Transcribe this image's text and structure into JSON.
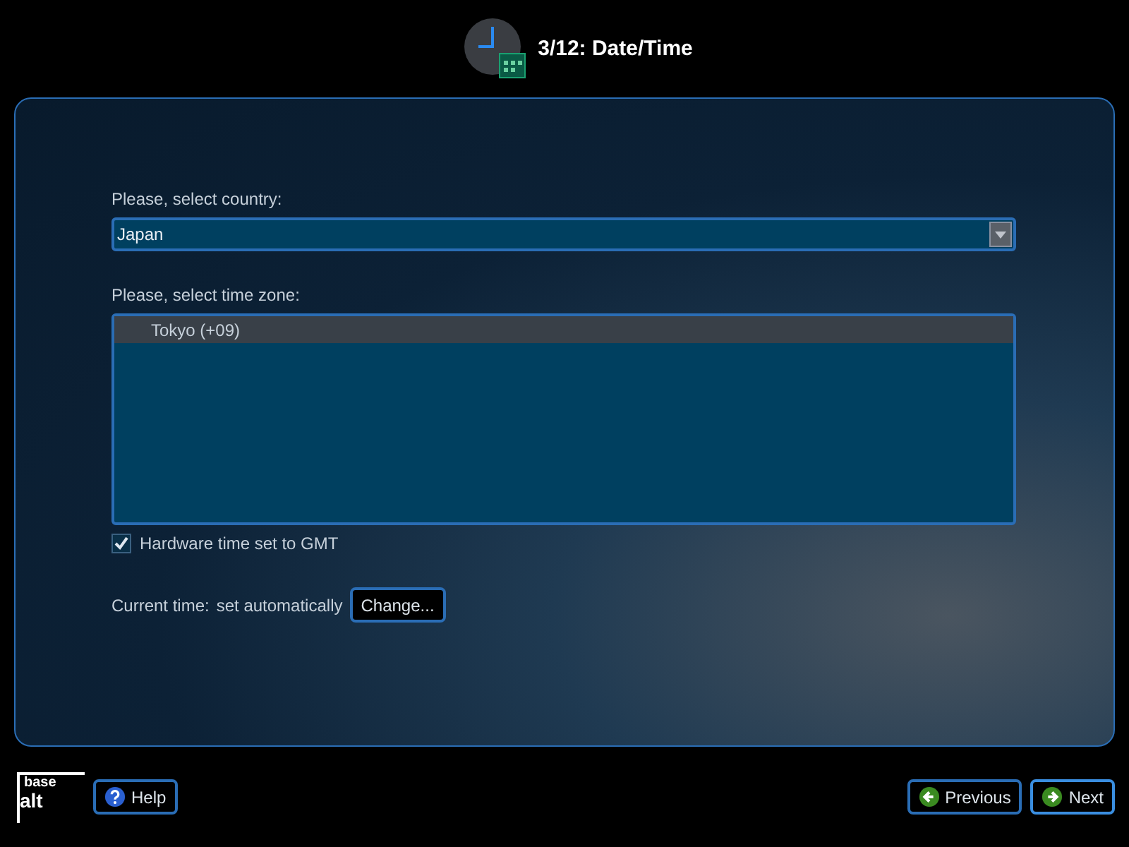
{
  "header": {
    "title": "3/12: Date/Time"
  },
  "country": {
    "label": "Please, select country:",
    "value": "Japan"
  },
  "timezone": {
    "label": "Please, select time zone:",
    "items": [
      {
        "label": "Tokyo (+09)",
        "selected": true
      }
    ]
  },
  "hardware_gmt": {
    "label": "Hardware time set to GMT",
    "checked": true
  },
  "current_time": {
    "label": "Current time:",
    "value": "set automatically",
    "button": "Change..."
  },
  "logo": {
    "line_1": "base",
    "line_2": "alt"
  },
  "buttons": {
    "help": "Help",
    "previous": "Previous",
    "next": "Next"
  }
}
